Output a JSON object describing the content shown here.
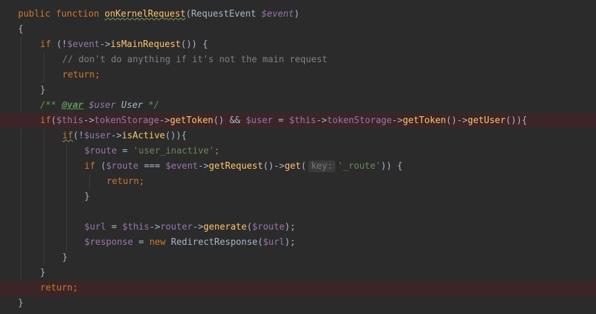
{
  "editor": {
    "lines": [
      [
        {
          "t": "public function ",
          "c": "kw"
        },
        {
          "t": "onKernelRequest",
          "c": "fn squig"
        },
        {
          "t": "(RequestEvent ",
          "c": ""
        },
        {
          "t": "$event",
          "c": "var-ital"
        },
        {
          "t": ")",
          "c": ""
        }
      ],
      [
        {
          "t": "{",
          "c": ""
        }
      ],
      [
        {
          "t": "if ",
          "c": "kw"
        },
        {
          "t": "(!",
          "c": ""
        },
        {
          "t": "$event",
          "c": "var"
        },
        {
          "t": "->",
          "c": ""
        },
        {
          "t": "isMainRequest",
          "c": "fn"
        },
        {
          "t": "()) {",
          "c": ""
        }
      ],
      [
        {
          "t": "// don't do anything if it's not the main request",
          "c": "cm"
        }
      ],
      [
        {
          "t": "return",
          "c": "kw"
        },
        {
          "t": ";",
          "c": "kw"
        }
      ],
      [
        {
          "t": "}",
          "c": ""
        }
      ],
      [
        {
          "t": "/** ",
          "c": "doc"
        },
        {
          "t": "@var",
          "c": "doc-tag"
        },
        {
          "t": " ",
          "c": "doc"
        },
        {
          "t": "$user",
          "c": "var-ital"
        },
        {
          "t": " User ",
          "c": "doc-type"
        },
        {
          "t": "*/",
          "c": "doc"
        }
      ],
      [
        {
          "t": "if",
          "c": "kw"
        },
        {
          "t": "(",
          "c": ""
        },
        {
          "t": "$this",
          "c": "var"
        },
        {
          "t": "->",
          "c": ""
        },
        {
          "t": "tokenStorage",
          "c": "var"
        },
        {
          "t": "->",
          "c": ""
        },
        {
          "t": "getToken",
          "c": "fn"
        },
        {
          "t": "() && ",
          "c": ""
        },
        {
          "t": "$user",
          "c": "var"
        },
        {
          "t": " = ",
          "c": ""
        },
        {
          "t": "$this",
          "c": "var"
        },
        {
          "t": "->",
          "c": ""
        },
        {
          "t": "tokenStorage",
          "c": "var"
        },
        {
          "t": "->",
          "c": ""
        },
        {
          "t": "getToken",
          "c": "fn"
        },
        {
          "t": "()->",
          "c": ""
        },
        {
          "t": "getUser",
          "c": "fn"
        },
        {
          "t": "()){",
          "c": ""
        }
      ],
      [
        {
          "t": "if",
          "c": "kw squig"
        },
        {
          "t": "(!",
          "c": ""
        },
        {
          "t": "$user",
          "c": "var"
        },
        {
          "t": "->",
          "c": ""
        },
        {
          "t": "isActive",
          "c": "fn"
        },
        {
          "t": "()){",
          "c": ""
        }
      ],
      [
        {
          "t": "$route",
          "c": "var"
        },
        {
          "t": " = ",
          "c": ""
        },
        {
          "t": "'user_inactive'",
          "c": "str"
        },
        {
          "t": ";",
          "c": "kw"
        }
      ],
      [
        {
          "t": "if ",
          "c": "kw"
        },
        {
          "t": "(",
          "c": ""
        },
        {
          "t": "$route",
          "c": "var"
        },
        {
          "t": " === ",
          "c": ""
        },
        {
          "t": "$event",
          "c": "var"
        },
        {
          "t": "->",
          "c": ""
        },
        {
          "t": "getRequest",
          "c": "fn"
        },
        {
          "t": "()->",
          "c": ""
        },
        {
          "t": "get",
          "c": "fn"
        },
        {
          "t": "(",
          "c": ""
        },
        {
          "t": "key:",
          "c": "hint"
        },
        {
          "t": "'_route'",
          "c": "str"
        },
        {
          "t": ")) {",
          "c": ""
        }
      ],
      [
        {
          "t": "return",
          "c": "kw"
        },
        {
          "t": ";",
          "c": "kw"
        }
      ],
      [
        {
          "t": "}",
          "c": ""
        }
      ],
      [],
      [
        {
          "t": "$url",
          "c": "var"
        },
        {
          "t": " = ",
          "c": ""
        },
        {
          "t": "$this",
          "c": "var"
        },
        {
          "t": "->",
          "c": ""
        },
        {
          "t": "router",
          "c": "var"
        },
        {
          "t": "->",
          "c": ""
        },
        {
          "t": "generate",
          "c": "fn"
        },
        {
          "t": "(",
          "c": ""
        },
        {
          "t": "$route",
          "c": "var"
        },
        {
          "t": ");",
          "c": ""
        }
      ],
      [
        {
          "t": "$response",
          "c": "var"
        },
        {
          "t": " = ",
          "c": ""
        },
        {
          "t": "new ",
          "c": "kw"
        },
        {
          "t": "RedirectResponse(",
          "c": ""
        },
        {
          "t": "$url",
          "c": "var"
        },
        {
          "t": ");",
          "c": ""
        }
      ],
      [
        {
          "t": "}",
          "c": ""
        }
      ],
      [
        {
          "t": "}",
          "c": ""
        }
      ],
      [
        {
          "t": "return",
          "c": "kw"
        },
        {
          "t": ";",
          "c": "kw"
        }
      ],
      [
        {
          "t": "}",
          "c": ""
        }
      ]
    ]
  }
}
